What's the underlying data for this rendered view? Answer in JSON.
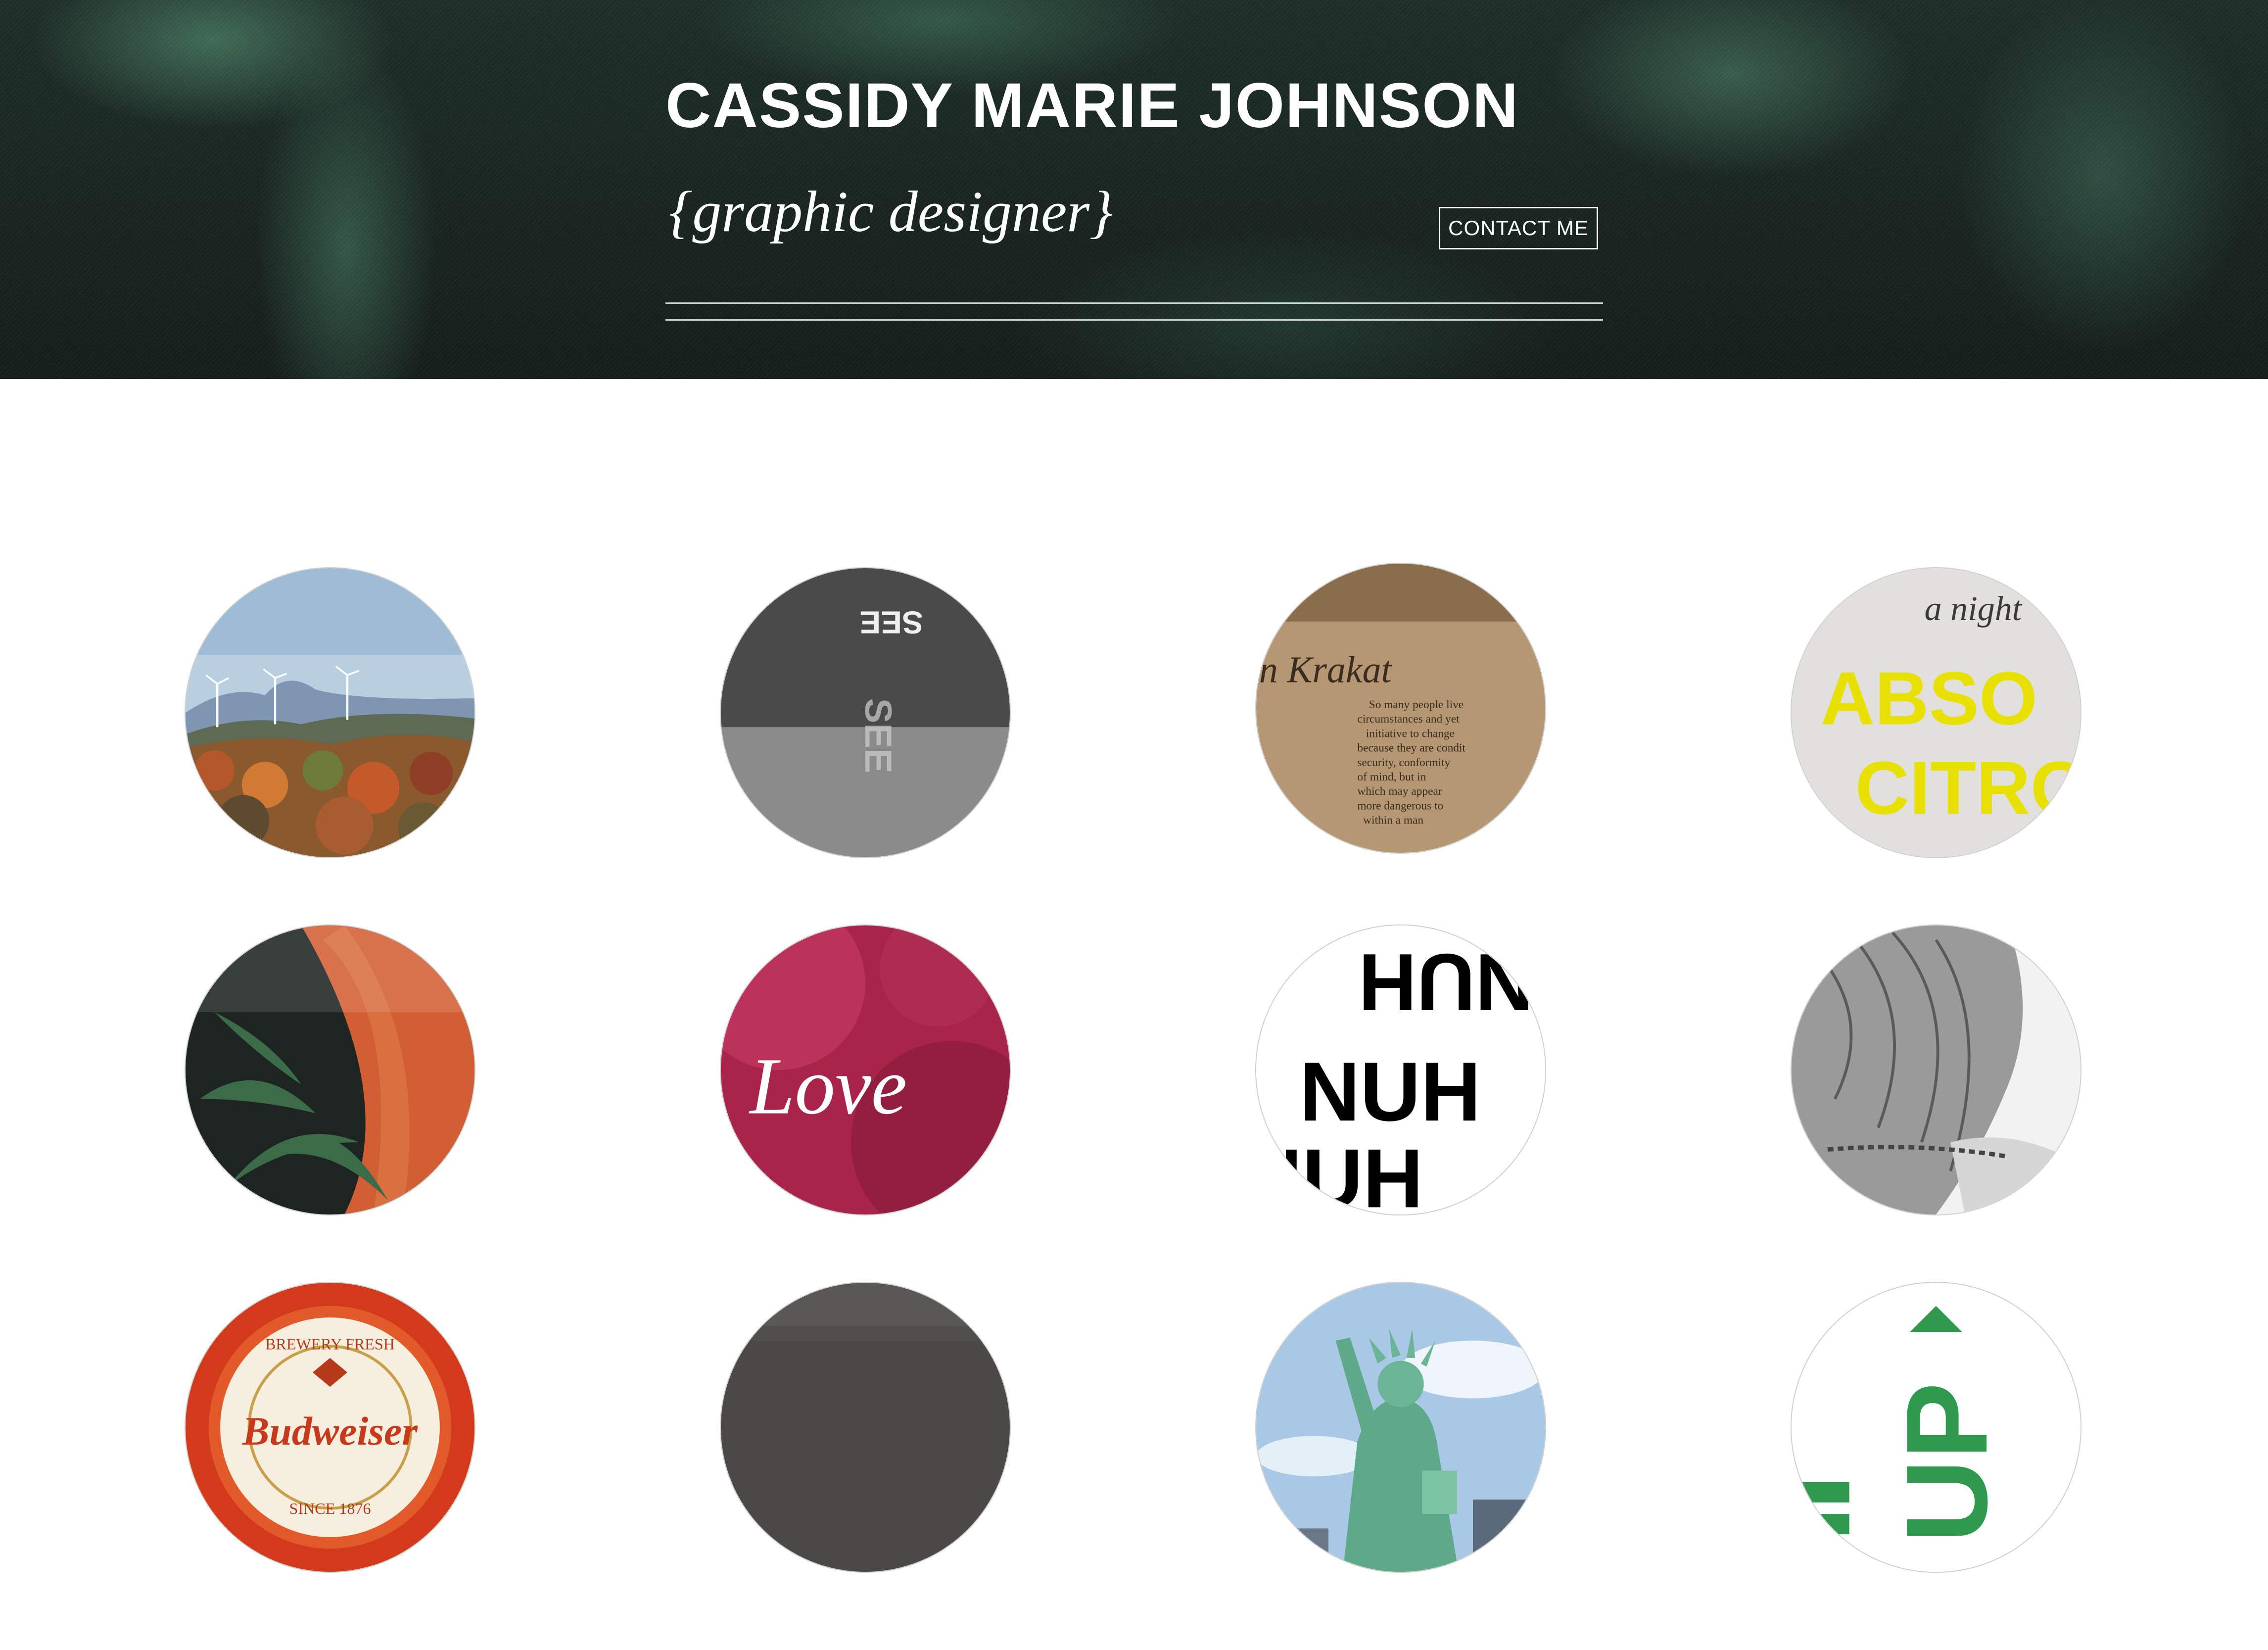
{
  "header": {
    "title": "CASSIDY MARIE JOHNSON",
    "subtitle": "{graphic designer}",
    "contact_label": "CONTACT ME"
  },
  "portfolio": {
    "items": [
      {
        "name": "wind-turbines-landscape-thumbnail",
        "texts": []
      },
      {
        "name": "see-typography-thumbnail",
        "texts": [
          "SEE",
          "SEE"
        ]
      },
      {
        "name": "krakatoa-book-thumbnail",
        "texts": [
          "n Krakat",
          "So many people live",
          "circumstances and yet",
          "initiative to change",
          "because they are condit",
          "security, conformity",
          "of mind, but in",
          "which may appear",
          "more dangerous to",
          "within a man"
        ]
      },
      {
        "name": "absolut-citron-thumbnail",
        "texts": [
          "a night",
          "ABSO",
          "CITRO"
        ]
      },
      {
        "name": "carrot-herbs-thumbnail",
        "texts": []
      },
      {
        "name": "love-watercolor-thumbnail",
        "texts": [
          "Love"
        ]
      },
      {
        "name": "nuh-typography-thumbnail",
        "texts": [
          "NUH",
          "NUH",
          "NUH"
        ]
      },
      {
        "name": "bw-portrait-thumbnail",
        "texts": []
      },
      {
        "name": "budweiser-coaster-thumbnail",
        "texts": [
          "BREWERY FRESH",
          "Budweiser",
          "SINCE 1876"
        ]
      },
      {
        "name": "gray-placeholder-thumbnail",
        "texts": []
      },
      {
        "name": "statue-of-liberty-thumbnail",
        "texts": []
      },
      {
        "name": "green-up-logo-thumbnail",
        "texts": [
          "UP"
        ]
      }
    ]
  }
}
